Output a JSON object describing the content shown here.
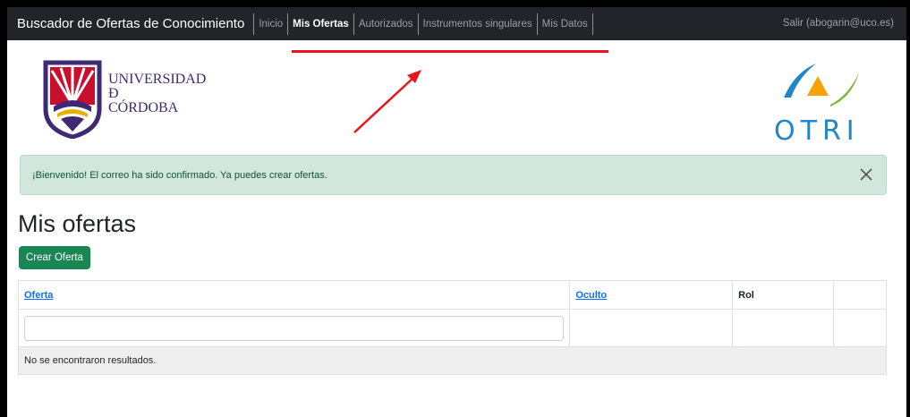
{
  "navbar": {
    "brand": "Buscador de Ofertas de Conocimiento",
    "items": [
      {
        "label": "Inicio",
        "active": false
      },
      {
        "label": "Mis Ofertas",
        "active": true
      },
      {
        "label": "Autorizados",
        "active": false
      },
      {
        "label": "Instrumentos singulares",
        "active": false
      },
      {
        "label": "Mis Datos",
        "active": false
      }
    ],
    "logout": "Salir (abogarin@uco.es)"
  },
  "logos": {
    "uco_lines": [
      "UNIVERSIDAD",
      "Ð",
      "CÓRDOBA"
    ],
    "otri": "OTRI"
  },
  "alert": {
    "message": "¡Bienvenido! El correo ha sido confirmado. Ya puedes crear ofertas."
  },
  "main": {
    "title": "Mis ofertas",
    "create_button": "Crear Oferta"
  },
  "table": {
    "headers": [
      {
        "label": "Oferta",
        "sortable": true
      },
      {
        "label": "Oculto",
        "sortable": true
      },
      {
        "label": "Rol",
        "sortable": false
      },
      {
        "label": "",
        "sortable": false
      }
    ],
    "filter_value": "",
    "empty_message": "No se encontraron resultados."
  },
  "colors": {
    "navbar_bg": "#212529",
    "success": "#198754",
    "alert_bg": "#d1e7dd",
    "link": "#0d6efd",
    "annotation": "#e8141c",
    "uco_purple": "#3d2a73",
    "otri_blue": "#1e86c9"
  }
}
